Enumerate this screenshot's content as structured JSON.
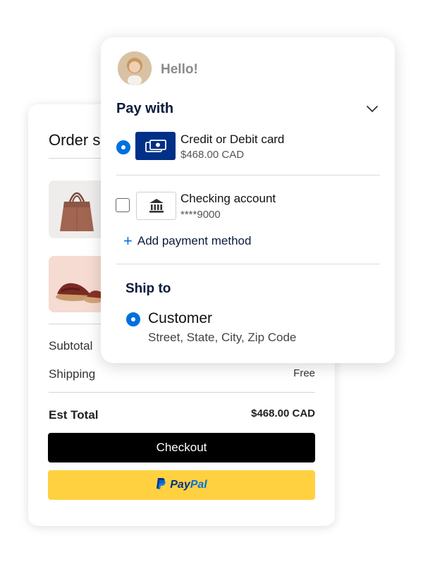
{
  "order": {
    "title": "Order s",
    "subtotal_label": "Subtotal",
    "shipping_label": "Shipping",
    "shipping_value": "Free",
    "est_total_label": "Est Total",
    "est_total_value": "$468.00 CAD",
    "checkout_label": "Checkout",
    "paypal_label_pay": "Pay",
    "paypal_label_pal": "Pal",
    "paypal_button_color": "#ffd140",
    "checkout_button_color": "#000000"
  },
  "pay": {
    "greeting": "Hello!",
    "heading": "Pay with",
    "methods": [
      {
        "title": "Credit or Debit card",
        "subtitle": "$468.00 CAD",
        "selected": true,
        "icon": "card-icon"
      },
      {
        "title": "Checking account",
        "subtitle": "****9000",
        "selected": false,
        "icon": "bank-icon"
      }
    ],
    "add_label": "Add payment method",
    "ship_heading": "Ship to",
    "ship_name": "Customer",
    "ship_address": "Street, State, City, Zip Code",
    "accent_color": "#0070e0",
    "navy_color": "#003087"
  }
}
